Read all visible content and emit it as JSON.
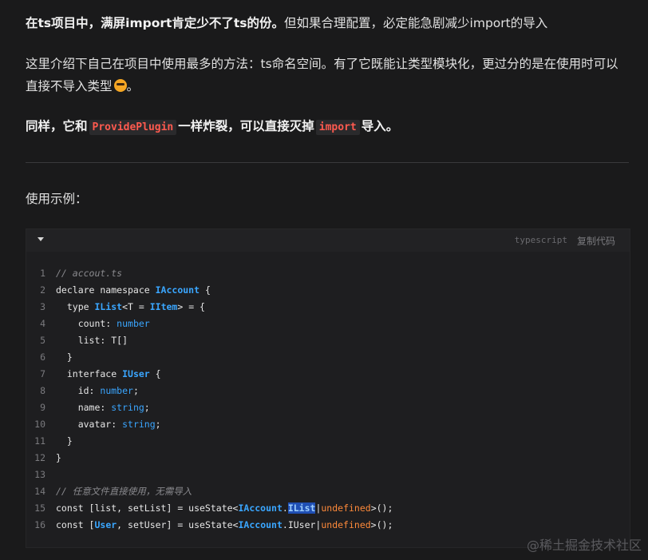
{
  "article": {
    "p1_bold": "在ts项目中，满屏import肯定少不了ts的份。",
    "p1_rest": "但如果合理配置，必定能急剧减少import的导入",
    "p2_text": "这里介绍下自己在项目中使用最多的方法：ts命名空间。有了它既能让类型模块化，更过分的是在使用时可以直接不导入类型",
    "p3_pre": "同样，它和",
    "p3_code1": "ProvidePlugin",
    "p3_mid": "一样炸裂，可以直接灭掉",
    "p3_code2": "import",
    "p3_post": "导入。",
    "p4_text": "使用示例："
  },
  "code_block": {
    "language": "typescript",
    "copy_label": "复制代码",
    "lines": [
      {
        "n": "1",
        "c": "// accout.ts"
      },
      {
        "n": "2",
        "a": "declare namespace ",
        "b": "IAccount",
        " c": " {"
      },
      {
        "n": "3",
        "a": "  type ",
        "b": "IList",
        "x": "<T = ",
        "y": "IItem",
        "z": "> = {"
      },
      {
        "n": "4",
        "a": "    count: ",
        "t": "number"
      },
      {
        "n": "5",
        "a": "    list: T[]"
      },
      {
        "n": "6",
        "a": "  }"
      },
      {
        "n": "7",
        "a": "  interface ",
        "b": "IUser",
        " c": " {"
      },
      {
        "n": "8",
        "a": "    id: ",
        "t": "number",
        ";": ";"
      },
      {
        "n": "9",
        "a": "    name: ",
        "t": "string",
        ";": ";"
      },
      {
        "n": "10",
        "a": "    avatar: ",
        "t": "string",
        ";": ";"
      },
      {
        "n": "11",
        "a": "  }"
      },
      {
        "n": "12",
        "a": "}"
      },
      {
        "n": "13",
        "a": ""
      },
      {
        "n": "14",
        "c": "// 任意文件直接使用，无需导入"
      },
      {
        "n": "15",
        "p1": "const [list, setList] = useState<",
        "p2": "IAccount",
        ".": ".",
        "p3": "IList",
        "p4": "|",
        "p5": "undefined",
        "p6": ">();"
      },
      {
        "n": "16",
        "p1": "const [",
        "u": "User",
        ", setUser] = useState<": ", setUser] = useState<",
        "p2": "IAccount",
        ".IUser|": ".IUser|",
        "p5": "undefined",
        "p6": ">();"
      }
    ]
  },
  "watermark": "@稀土掘金技术社区"
}
